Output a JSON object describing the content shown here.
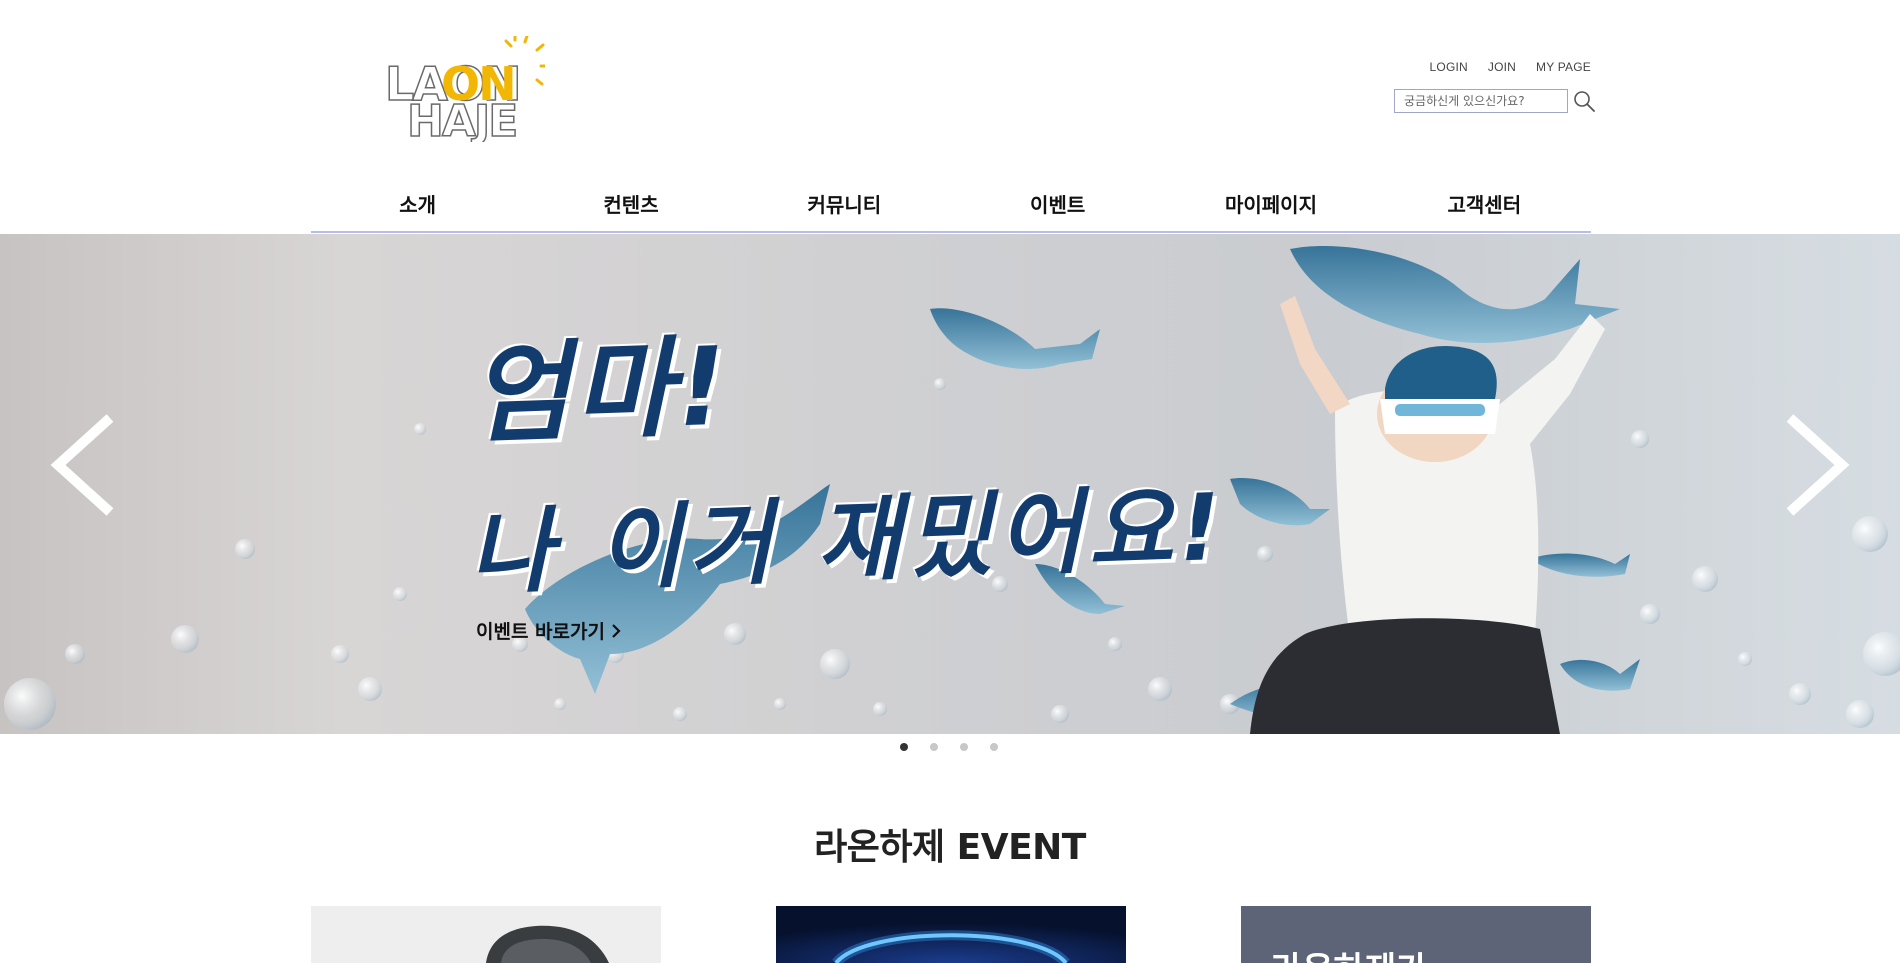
{
  "brand": {
    "logo_top": "LAON",
    "logo_bottom": "HAJE",
    "colors": {
      "outline": "#6a6a6a",
      "accent": "#f2b705"
    }
  },
  "header": {
    "util_links": [
      "LOGIN",
      "JOIN",
      "MY PAGE"
    ],
    "search": {
      "placeholder": "궁금하신게 있으신가요?",
      "value": "",
      "icon": "search-icon"
    }
  },
  "nav": {
    "items": [
      "소개",
      "컨텐츠",
      "커뮤니티",
      "이벤트",
      "마이페이지",
      "고객센터"
    ],
    "underline_color": "#b8bde6"
  },
  "hero": {
    "headline_1": "엄마!",
    "headline_2": "나 이거 재밌어요!",
    "cta_label": "이벤트 바로가기",
    "prev_icon": "chevron-left-icon",
    "next_icon": "chevron-right-icon",
    "headline_color": "#133c6e",
    "slide_count": 4,
    "active_slide": 1
  },
  "event": {
    "title": "라온하제 EVENT",
    "cards": [
      {
        "name": "vr-headset-card"
      },
      {
        "name": "blue-ring-card"
      },
      {
        "name": "laon-text-card",
        "label": "라온하제가"
      }
    ]
  }
}
